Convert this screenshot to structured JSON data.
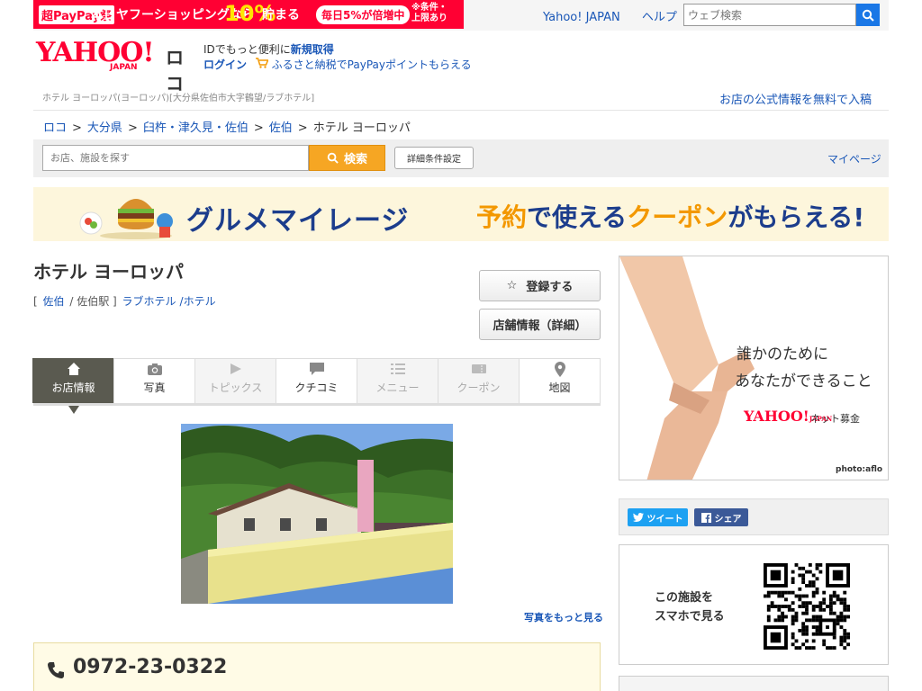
{
  "promo": {
    "tag": "超PayPay祭",
    "text": "本日ヤフーショッピングなら",
    "percent": "10%",
    "text2": "貯まる",
    "pill": "毎日5%が倍増中",
    "note_line1": "※条件・",
    "note_line2": "上限あり"
  },
  "top_nav": {
    "yahoo_link": "Yahoo! JAPAN",
    "help_link": "ヘルプ",
    "search_placeholder": "ウェブ検索"
  },
  "header": {
    "logo": "YAHOO!",
    "logo_sub": "JAPAN",
    "service": "ロコ",
    "id_text": "IDでもっと便利に",
    "signup": "新規取得",
    "login": "ログイン",
    "furusato": "ふるさと納税でPayPayポイントもらえる",
    "subtitle": "ホテル ヨーロッパ(ヨーロッパ)[大分県佐伯市大字鶴望/ラブホテル]",
    "official": "お店の公式情報を無料で入稿"
  },
  "breadcrumb": [
    "ロコ",
    "大分県",
    "臼杵・津久見・佐伯",
    "佐伯",
    "ホテル ヨーロッパ"
  ],
  "search": {
    "placeholder": "お店、施設を探す",
    "button": "検索",
    "detail": "詳細条件設定",
    "mypage": "マイページ"
  },
  "banner": {
    "part1": "グルメマイレージ",
    "part2a": "予約",
    "part2b": "で使える",
    "part2c": "クーポン",
    "part2d": "がもらえる!"
  },
  "shop": {
    "name": "ホテル ヨーロッパ",
    "area": "佐伯",
    "station": "佐伯駅",
    "category1": "ラブホテル",
    "category2": "/ホテル",
    "fav_button": "登録する",
    "info_button": "店舗情報（詳細）",
    "more_photos": "写真をもっと見る",
    "phone": "0972-23-0322"
  },
  "tabs": [
    {
      "label": "お店情報"
    },
    {
      "label": "写真"
    },
    {
      "label": "トピックス"
    },
    {
      "label": "クチコミ"
    },
    {
      "label": "メニュー"
    },
    {
      "label": "クーポン"
    },
    {
      "label": "地図"
    }
  ],
  "sidebar": {
    "ad_line1": "誰かのために",
    "ad_line2": "あなたができること",
    "ad_logo": "YAHOO!",
    "ad_logo_sub": "JAPAN",
    "ad_service": "ネット募金",
    "ad_credit": "photo:aflo",
    "tweet": "ツイート",
    "share": "シェア",
    "qr_line1": "この施設を",
    "qr_line2": "スマホで見る"
  },
  "colors": {
    "yahoo_red": "#ff0033",
    "link_blue": "#1a57b7",
    "search_orange": "#f6a623",
    "active_tab": "#5a5a50"
  }
}
